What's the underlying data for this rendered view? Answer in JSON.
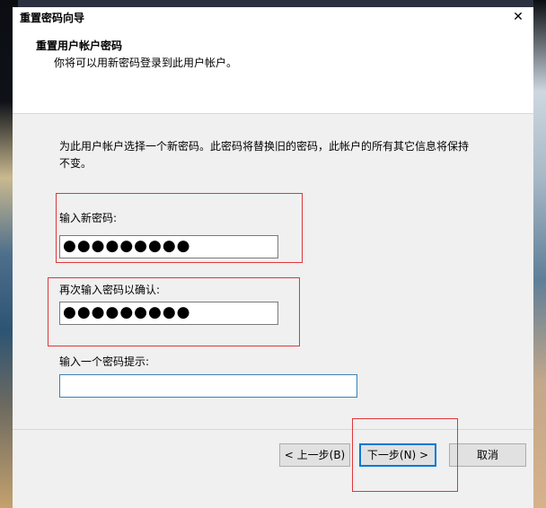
{
  "window": {
    "title": "重置密码向导",
    "close_glyph": "✕"
  },
  "header": {
    "title": "重置用户帐户密码",
    "subtitle": "你将可以用新密码登录到此用户帐户。"
  },
  "body": {
    "description": "为此用户帐户选择一个新密码。此密码将替换旧的密码，此帐户的所有其它信息将保持不变。"
  },
  "fields": {
    "new_password": {
      "label": "输入新密码:",
      "value": "●●●●●●●●●"
    },
    "confirm_password": {
      "label": "再次输入密码以确认:",
      "value": "●●●●●●●●●"
    },
    "hint": {
      "label": "输入一个密码提示:",
      "value": ""
    }
  },
  "buttons": {
    "back": "< 上一步(B)",
    "next": "下一步(N) >",
    "cancel": "取消"
  },
  "colors": {
    "highlight_box": "#e0363a",
    "default_button_border": "#0078d7"
  }
}
